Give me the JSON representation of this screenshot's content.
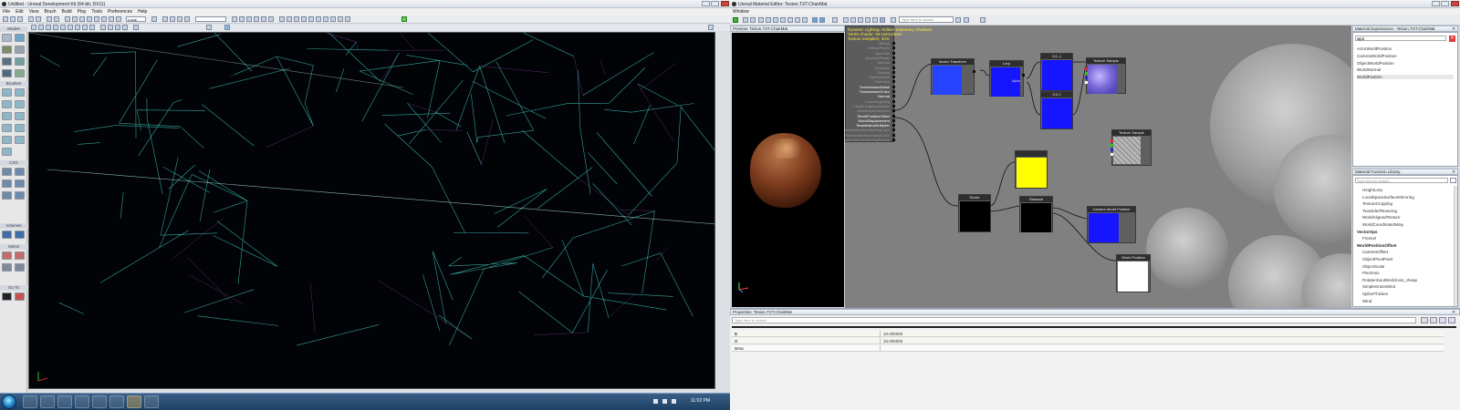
{
  "editor": {
    "title": "Untitled - Unreal Development Kit (64-bit, DX11)",
    "menus": [
      "File",
      "Edit",
      "View",
      "Brush",
      "Build",
      "Play",
      "Tools",
      "Preferences",
      "Help"
    ],
    "coord_system": "Local",
    "mode_sections": [
      "Modes",
      "Brushes",
      "CSG",
      "Volumes",
      "Select",
      "Go To"
    ]
  },
  "taskbar": {
    "clock": "11:02 PM"
  },
  "material_editor": {
    "title": "Unreal Material Editor: Tesion.TXT.ChairMat",
    "menu": [
      "Window"
    ],
    "search_placeholder": "Type here to search",
    "preview_title": "Preview: Tesion.TXT.ChairMat",
    "stats_lines": [
      "Dynamic Lighting: Hidden Stationary Shadows",
      "Vertex shader: 89 instructions",
      "Texture samplers: 3/16"
    ],
    "root_inputs": [
      {
        "label": "Diffuse",
        "active": false
      },
      {
        "label": "DiffusePower",
        "active": false
      },
      {
        "label": "Specular",
        "active": false
      },
      {
        "label": "SpecularPower",
        "active": false
      },
      {
        "label": "Normal",
        "active": false
      },
      {
        "label": "Emissive",
        "active": false
      },
      {
        "label": "Opacity",
        "active": false
      },
      {
        "label": "OpacityMask",
        "active": false
      },
      {
        "label": "Distortion",
        "active": false
      },
      {
        "label": "TransmissionMask",
        "active": true
      },
      {
        "label": "TransmissionColor",
        "active": true
      },
      {
        "label": "Normal",
        "active": true
      },
      {
        "label": "CustomLighting",
        "active": false
      },
      {
        "label": "CustomLightingDiffuse",
        "active": false
      },
      {
        "label": "AnisotropicDirection",
        "active": false
      },
      {
        "label": "WorldPositionOffset",
        "active": true
      },
      {
        "label": "WorldDisplacement",
        "active": true
      },
      {
        "label": "TessellationMultiplier",
        "active": true
      },
      {
        "label": "SubsurfaceInscatteringColor",
        "active": false
      },
      {
        "label": "SubsurfaceAbsorptionColor",
        "active": false
      },
      {
        "label": "SubsurfaceScatteringRadius",
        "active": false
      }
    ],
    "nodes": {
      "vector_transform": "Vector Transform",
      "lerp": "Lerp",
      "const_a": "0,0,-1",
      "const_b": "0,0,1",
      "texture_sample_1": "Texture Sample",
      "texture_sample_2": "Texture Sample",
      "divide": "Divide",
      "distance": "Distance",
      "camera_world_position": "Camera World Position",
      "world_position": "World Position"
    },
    "lerp_alpha_label": "Alpha",
    "node_colors": {
      "blue": "#1515ff",
      "yellow": "#ffff00",
      "black": "#000000",
      "white": "#ffffff"
    },
    "material_expressions": {
      "title": "Material Expressions - Tesion.TXT.ChairMat",
      "filter": "wpo",
      "items": [
        "ActorWorldPosition",
        "CameraWorldPosition",
        "ObjectWorldPosition",
        "WorldNormal",
        "WorldPosition"
      ],
      "selected_index": 4
    },
    "function_library": {
      "title": "Material Function Library",
      "search_placeholder": "Type here to search",
      "items": [
        {
          "label": "HeightLerp",
          "kind": "item"
        },
        {
          "label": "LocalSpaceSurfaceMirroring",
          "kind": "item"
        },
        {
          "label": "TextureCropping",
          "kind": "item"
        },
        {
          "label": "TwoSidedTexturing",
          "kind": "item"
        },
        {
          "label": "WorldAlignedTexture",
          "kind": "item"
        },
        {
          "label": "WorldCoordinate3Way",
          "kind": "item"
        },
        {
          "label": "VectorOps",
          "kind": "cat"
        },
        {
          "label": "Fresnel",
          "kind": "item"
        },
        {
          "label": "WorldPositionOffset",
          "kind": "cat"
        },
        {
          "label": "CameraOffset",
          "kind": "item"
        },
        {
          "label": "ObjectPivotPoint",
          "kind": "item"
        },
        {
          "label": "ObjectScale",
          "kind": "item"
        },
        {
          "label": "PivotAxis",
          "kind": "item"
        },
        {
          "label": "RotateAboutWorldAxis_cheap",
          "kind": "item"
        },
        {
          "label": "SimpleGrassWind",
          "kind": "item"
        },
        {
          "label": "SplineThicken",
          "kind": "item"
        },
        {
          "label": "Wind",
          "kind": "item"
        }
      ]
    },
    "properties": {
      "title": "Properties: Tesion.TXT.ChairMat",
      "search_placeholder": "Type here to search",
      "rows": [
        {
          "key": "B",
          "value": "10.000000"
        },
        {
          "key": "G",
          "value": "10.000000"
        },
        {
          "key": "Desc",
          "value": ""
        }
      ]
    }
  }
}
